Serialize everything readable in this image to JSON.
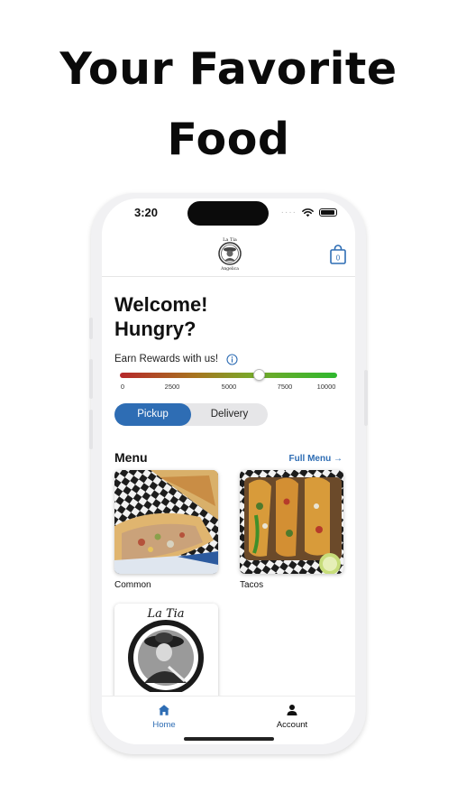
{
  "promo": {
    "line1": "Your Favorite",
    "line2": "Food"
  },
  "status_bar": {
    "time": "3:20"
  },
  "header": {
    "logo_icon": "la-tia-logo-icon",
    "cart_icon": "shopping-bag-icon",
    "cart_count": "0"
  },
  "welcome": {
    "line1": "Welcome!",
    "line2": "Hungry?"
  },
  "rewards": {
    "label": "Earn Rewards with us!",
    "info_icon": "info-circle-icon",
    "progress_fraction": 0.64,
    "ticks": [
      "0",
      "2500",
      "5000",
      "7500",
      "10000"
    ]
  },
  "order_type": {
    "options": [
      "Pickup",
      "Delivery"
    ],
    "selected": "Pickup"
  },
  "menu": {
    "title": "Menu",
    "full_menu_link": "Full Menu →",
    "items": [
      {
        "label": "Common"
      },
      {
        "label": "Tacos"
      },
      {
        "label": ""
      }
    ]
  },
  "tabbar": {
    "items": [
      {
        "label": "Home",
        "icon": "home-icon",
        "active": true
      },
      {
        "label": "Account",
        "icon": "person-icon",
        "active": false
      }
    ]
  },
  "colors": {
    "accent": "#2e6db4",
    "active_tab": "#2e6db4",
    "text": "#111111"
  }
}
